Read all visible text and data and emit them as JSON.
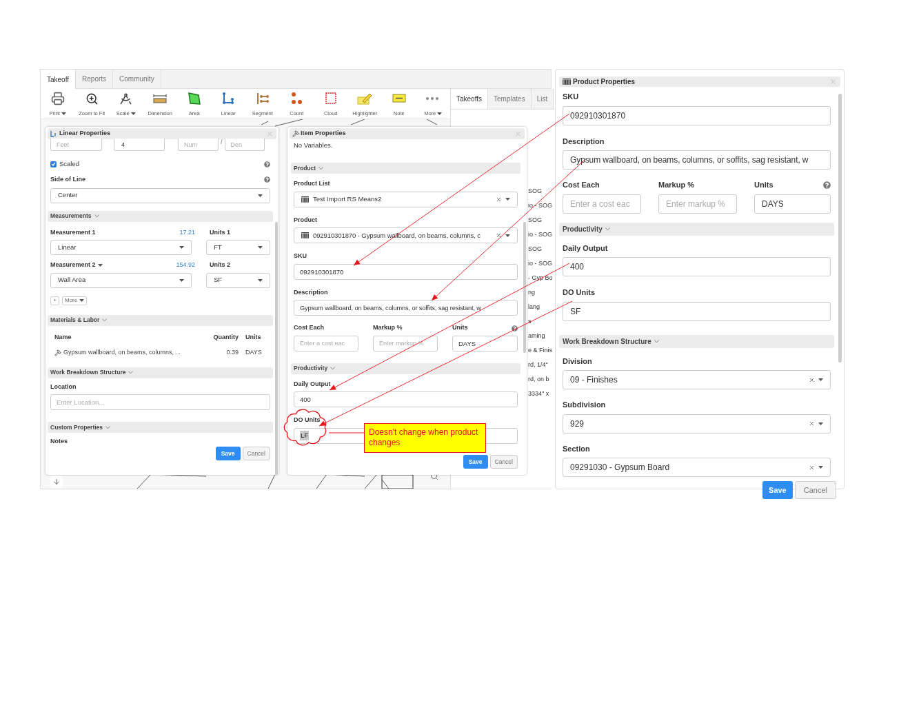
{
  "app_tabs": [
    {
      "label": "Takeoff",
      "selected": true
    },
    {
      "label": "Reports",
      "selected": false
    },
    {
      "label": "Community",
      "selected": false
    }
  ],
  "toolbar": [
    {
      "kind": "print",
      "label": "Print",
      "dropdown": true
    },
    {
      "kind": "zoom",
      "label": "Zoom to Fit",
      "dropdown": false
    },
    {
      "kind": "scale",
      "label": "Scale",
      "dropdown": true
    },
    {
      "kind": "dimension",
      "label": "Dimension",
      "dropdown": false
    },
    {
      "kind": "area",
      "label": "Area",
      "dropdown": false
    },
    {
      "kind": "linear",
      "label": "Linear",
      "dropdown": false
    },
    {
      "kind": "segment",
      "label": "Segment",
      "dropdown": false
    },
    {
      "kind": "count",
      "label": "Count",
      "dropdown": false
    },
    {
      "kind": "cloud",
      "label": "Cloud",
      "dropdown": false
    },
    {
      "kind": "highlighter",
      "label": "Highlighter",
      "dropdown": false
    },
    {
      "kind": "note",
      "label": "Note",
      "dropdown": false
    },
    {
      "kind": "more",
      "label": "More",
      "dropdown": true
    }
  ],
  "side_tabs": [
    {
      "label": "Takeoffs",
      "selected": true
    },
    {
      "label": "Templates",
      "selected": false
    },
    {
      "label": "List",
      "selected": false
    }
  ],
  "side_list": [
    "SOG",
    "io - SOG",
    "SOG",
    "io - SOG",
    "SOG",
    "io - SOG",
    "- Gyp Bo",
    "ng",
    "lang",
    "s",
    "aming",
    "e & Finis",
    "rd, 1/4\"",
    "rd, on b",
    "3334\" x"
  ],
  "linear_properties": {
    "title": "Linear Properties",
    "scale_inputs": {
      "feet_placeholder": "Feet",
      "inches": "4",
      "numerator_placeholder": "Num",
      "separator": "/",
      "denominator_placeholder": "Den"
    },
    "scaled": {
      "label": "Scaled",
      "checked": true
    },
    "side_of_line": {
      "label": "Side of Line",
      "value": "Center"
    },
    "measurements": {
      "title": "Measurements",
      "rows": [
        {
          "label": "Measurement 1",
          "dropdown": false,
          "reading": "17.21",
          "value": "Linear",
          "units_label": "Units 1",
          "units": "FT"
        },
        {
          "label": "Measurement 2",
          "dropdown": true,
          "reading": "154.92",
          "value": "Wall Area",
          "units_label": "Units 2",
          "units": "SF"
        }
      ],
      "add_button": "+",
      "more_button": "More"
    },
    "materials": {
      "title": "Materials & Labor",
      "columns": [
        "Name",
        "Quantity",
        "Units"
      ],
      "rows": [
        {
          "name": "Gypsum wallboard, on beams, columns, ...",
          "quantity": "0.39",
          "units": "DAYS"
        }
      ]
    },
    "wbs": {
      "title": "Work Breakdown Structure",
      "location_label": "Location",
      "location_placeholder": "Enter Location..."
    },
    "custom": {
      "title": "Custom Properties",
      "notes_label": "Notes"
    },
    "buttons": {
      "save": "Save",
      "cancel": "Cancel"
    }
  },
  "item_properties": {
    "title": "Item Properties",
    "note": "No Variables.",
    "product_section": "Product",
    "product_list": {
      "label": "Product List",
      "value": "Test Import RS Means2"
    },
    "product": {
      "label": "Product",
      "value": "092910301870 - Gypsum wallboard, on beams, columns, c"
    },
    "sku": {
      "label": "SKU",
      "value": "092910301870"
    },
    "description": {
      "label": "Description",
      "value": "Gypsum wallboard, on beams, columns, or soffits, sag resistant, w"
    },
    "cost_each": {
      "label": "Cost Each",
      "placeholder": "Enter a cost eac"
    },
    "markup": {
      "label": "Markup %",
      "placeholder": "Enter markup %"
    },
    "units": {
      "label": "Units",
      "value": "DAYS"
    },
    "productivity_section": "Productivity",
    "daily_output": {
      "label": "Daily Output",
      "value": "400"
    },
    "do_units": {
      "label": "DO Units",
      "value": "LF",
      "highlighted": true
    },
    "buttons": {
      "save": "Save",
      "cancel": "Cancel"
    }
  },
  "product_properties": {
    "title": "Product Properties",
    "sku": {
      "label": "SKU",
      "value": "092910301870"
    },
    "description": {
      "label": "Description",
      "value": "Gypsum wallboard, on beams, columns, or soffits, sag resistant, w"
    },
    "cost_each": {
      "label": "Cost Each",
      "placeholder": "Enter a cost eac"
    },
    "markup": {
      "label": "Markup %",
      "placeholder": "Enter markup %"
    },
    "units": {
      "label": "Units",
      "value": "DAYS"
    },
    "productivity_section": "Productivity",
    "daily_output": {
      "label": "Daily Output",
      "value": "400"
    },
    "do_units": {
      "label": "DO Units",
      "value": "SF"
    },
    "wbs_section": "Work Breakdown Structure",
    "division": {
      "label": "Division",
      "value": "09 - Finishes"
    },
    "subdivision": {
      "label": "Subdivision",
      "value": "929"
    },
    "section": {
      "label": "Section",
      "value": "09291030 - Gypsum Board"
    },
    "buttons": {
      "save": "Save",
      "cancel": "Cancel"
    }
  },
  "annotation": {
    "callout": "Doesn't change when product changes"
  }
}
